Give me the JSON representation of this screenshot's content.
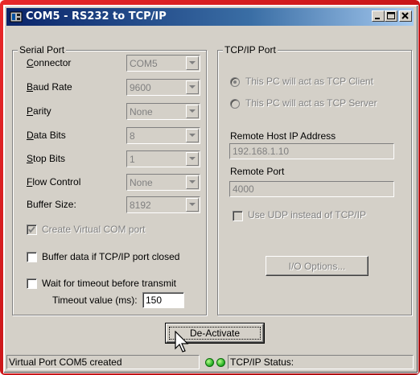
{
  "window": {
    "title": "COM5 - RS232 to TCP/IP",
    "buttons": {
      "minimize": "_",
      "maximize": "□",
      "close": "×"
    }
  },
  "serial_port": {
    "group_label": "Serial Port",
    "fields": [
      {
        "label_first": "C",
        "label_rest": "onnector",
        "value": "COM5"
      },
      {
        "label_first": "B",
        "label_rest": "aud Rate",
        "value": "9600"
      },
      {
        "label_first": "P",
        "label_rest": "arity",
        "value": "None"
      },
      {
        "label_first": "D",
        "label_rest": "ata Bits",
        "value": "8"
      },
      {
        "label_first": "S",
        "label_rest": "top Bits",
        "value": "1"
      },
      {
        "label_first": "F",
        "label_rest": "low Control",
        "value": "None"
      },
      {
        "label_first": "",
        "label_rest": "Buffer Size:",
        "value": "8192"
      }
    ],
    "create_virtual_com": {
      "label": "Create Virtual COM port",
      "checked": true,
      "enabled": false
    },
    "buffer_data": {
      "label": "Buffer data if TCP/IP port closed",
      "checked": false
    },
    "wait_timeout": {
      "label": "Wait for timeout before transmit",
      "checked": false
    },
    "timeout_label": "Timeout value (ms):",
    "timeout_value": "150"
  },
  "tcpip_port": {
    "group_label": "TCP/IP Port",
    "client_option": {
      "label": "This PC will act as TCP Client",
      "selected": true
    },
    "server_option": {
      "label": "This PC will act as TCP Server",
      "selected": false
    },
    "remote_host_label": "Remote Host IP Address",
    "remote_host_value": "192.168.1.10",
    "remote_port_label": "Remote Port",
    "remote_port_value": "4000",
    "udp_option": {
      "label": "Use UDP instead of TCP/IP",
      "checked": false
    },
    "io_options_button": "I/O Options..."
  },
  "actions": {
    "deactivate_button": "De-Activate"
  },
  "status_bar": {
    "message": "Virtual Port COM5 created",
    "tcp_status_label": "TCP/IP Status:"
  },
  "colors": {
    "frame_red": "#d01a1c",
    "title_blue": "#0a246a",
    "led_green": "#1faa1f",
    "face": "#d4d0c8"
  }
}
